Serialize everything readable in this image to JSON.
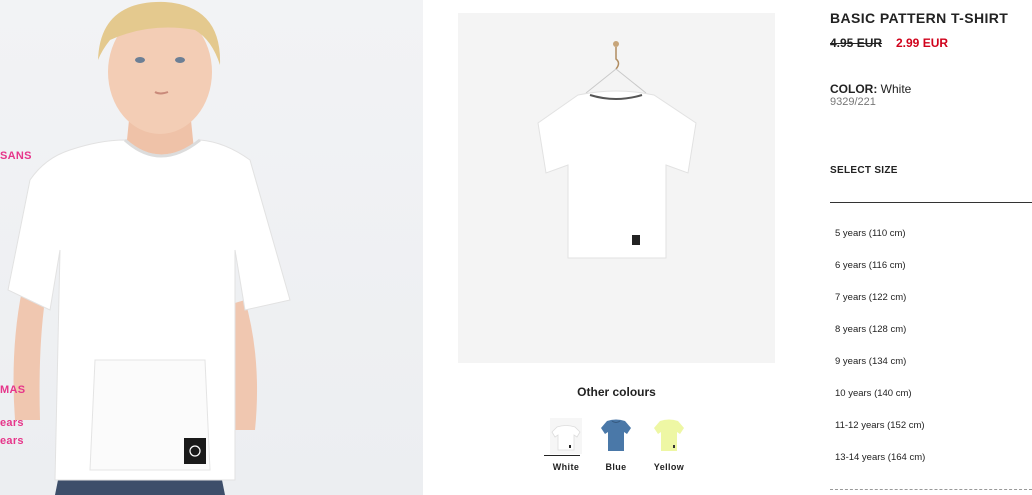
{
  "left_nav": {
    "links": [
      "SANS",
      "MAS",
      "ears",
      "ears"
    ]
  },
  "product": {
    "title": "BASIC PATTERN T-SHIRT",
    "old_price": "4.95 EUR",
    "new_price": "2.99 EUR",
    "color_label": "COLOR:",
    "color_value": "White",
    "reference": "9329/221"
  },
  "other_colours": {
    "title": "Other colours",
    "swatches": [
      {
        "label": "White",
        "color": "#ffffff",
        "selected": true
      },
      {
        "label": "Blue",
        "color": "#4a78a8",
        "selected": false
      },
      {
        "label": "Yellow",
        "color": "#eef7a4",
        "selected": false
      }
    ]
  },
  "sizes": {
    "heading": "SELECT SIZE",
    "items": [
      "5 years (110 cm)",
      "6 years (116 cm)",
      "7 years (122 cm)",
      "8 years (128 cm)",
      "9 years (134 cm)",
      "10 years (140 cm)",
      "11-12 years (152 cm)",
      "13-14 years (164 cm)"
    ]
  },
  "colors": {
    "accent_pink": "#e6358a",
    "sale_red": "#d0021b"
  }
}
